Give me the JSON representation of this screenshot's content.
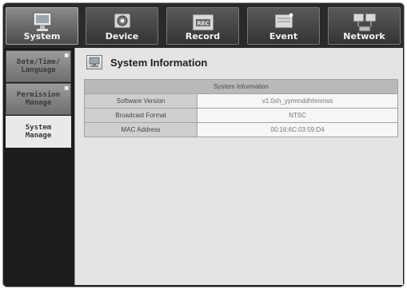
{
  "tabs": [
    {
      "label": "System",
      "icon": "monitor-icon",
      "active": true
    },
    {
      "label": "Device",
      "icon": "camera-icon",
      "active": false
    },
    {
      "label": "Record",
      "icon": "record-icon",
      "active": false
    },
    {
      "label": "Event",
      "icon": "event-icon",
      "active": false
    },
    {
      "label": "Network",
      "icon": "network-icon",
      "active": false
    }
  ],
  "sidebar": {
    "items": [
      {
        "label": "Date/Time/\nLanguage",
        "active": false
      },
      {
        "label": "Permission\nManage",
        "active": false
      },
      {
        "label": "System\nManage",
        "active": true
      }
    ]
  },
  "main": {
    "title": "System Information",
    "table": {
      "header": "System Information",
      "rows": [
        {
          "key": "Software Version",
          "value": "v1.0xh_yymmddhhmmss"
        },
        {
          "key": "Broadcast Format",
          "value": "NTSC"
        },
        {
          "key": "MAC Address",
          "value": "00:16:6C:03:59:D4"
        }
      ]
    }
  },
  "colors": {
    "frame_bg": "#1c1c1c",
    "panel_bg": "#e4e4e4",
    "table_header": "#b9b9b9"
  }
}
